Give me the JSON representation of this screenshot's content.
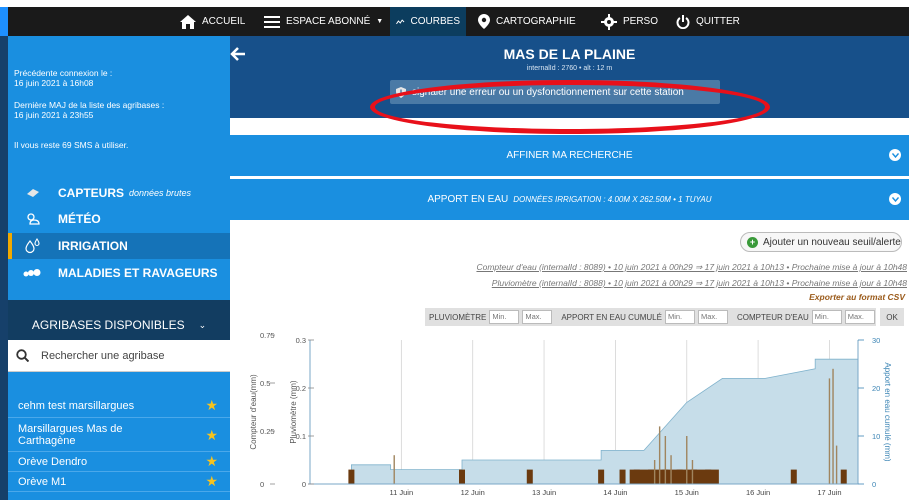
{
  "nav": {
    "items": [
      {
        "label": "ACCUEIL",
        "icon": "home-icon"
      },
      {
        "label": "ESPACE ABONNÉ",
        "icon": "menu-icon"
      },
      {
        "label": "COURBES",
        "icon": "chart-line-icon",
        "active": true
      },
      {
        "label": "CARTOGRAPHIE",
        "icon": "map-pin-icon"
      },
      {
        "label": "PERSO",
        "icon": "gear-icon"
      },
      {
        "label": "QUITTER",
        "icon": "power-icon"
      }
    ]
  },
  "sidebar": {
    "last_connection_label": "Précédente connexion le :",
    "last_connection_value": "16 juin 2021 à 16h08",
    "last_update_label": "Dernière MAJ de la liste des agribases :",
    "last_update_value": "16 juin 2021 à 23h55",
    "sms_left": "Il vous reste 69 SMS à utiliser.",
    "menu": [
      {
        "label": "CAPTEURS",
        "sub": "données brutes",
        "icon": "sensor-icon"
      },
      {
        "label": "MÉTÉO",
        "icon": "weather-icon"
      },
      {
        "label": "IRRIGATION",
        "icon": "water-drops-icon",
        "active": true
      },
      {
        "label": "MALADIES ET RAVAGEURS",
        "icon": "bug-icon"
      }
    ],
    "agribases_title": "AGRIBASES DISPONIBLES",
    "search_placeholder": "Rechercher une agribase",
    "agribases": [
      {
        "label": "cehm test marsillargues"
      },
      {
        "label": "Marsillargues Mas de Carthagène"
      },
      {
        "label": "Orève Dendro"
      },
      {
        "label": "Orève M1"
      }
    ]
  },
  "station": {
    "title": "MAS DE LA PLAINE",
    "subtitle": "internalId : 2760 • alt : 12 m",
    "report_button": "signaler une erreur ou un dysfonctionnement sur cette station"
  },
  "sections": {
    "refine": "AFFINER MA RECHERCHE",
    "water_title": "APPORT EN EAU",
    "water_sub": "DONNÉES IRRIGATION : 4.00M X 262.50M • 1 TUYAU"
  },
  "add_threshold": "Ajouter un nouveau seuil/alerte",
  "sources": [
    "Compteur d'eau (internalId : 8089) • 10 juin 2021 à 00h29 ⇒ 17 juin 2021 à 10h13 • Prochaine mise à jour à 10h48",
    "Pluviomètre (internalId : 8088) • 10 juin 2021 à 00h29 ⇒ 17 juin 2021 à 10h13 • Prochaine mise à jour à 10h48"
  ],
  "export_label": "Exporter au format CSV",
  "filters": {
    "pluvio": "PLUVIOMÈTRE",
    "cumul": "APPORT EN EAU CUMULÉ",
    "compteur": "COMPTEUR D'EAU",
    "min": "Min.",
    "max": "Max.",
    "ok": "OK"
  },
  "chart_data": {
    "type": "bar",
    "x_dates": [
      "11 Juin",
      "12 Juin",
      "13 Juin",
      "14 Juin",
      "15 Juin",
      "16 Juin",
      "17 Juin"
    ],
    "ylabel_left1": "Compteur d'eau(mm)",
    "ylabel_left2": "Pluviomètre (mm)",
    "ylabel_right": "Apport en eau cumulé (mm)",
    "y_left1_ticks": [
      "0",
      "0.25",
      "0.5",
      "0.75"
    ],
    "y_left2_ticks": [
      "0",
      "0.1",
      "0.2",
      "0.3"
    ],
    "y_right_ticks": [
      "0",
      "10",
      "20",
      "30"
    ],
    "ylim_left1": [
      0,
      0.75
    ],
    "ylim_left2": [
      0,
      0.3
    ],
    "ylim_right": [
      0,
      30
    ],
    "cumul_series": {
      "name": "Apport en eau cumulé",
      "color": "#c6dde9",
      "x": [
        10.3,
        10.85,
        10.85,
        11.85,
        11.85,
        13.8,
        13.8,
        14.4,
        15.0,
        15.5,
        16.1,
        16.8,
        16.8,
        17.4
      ],
      "y": [
        4,
        4,
        3,
        3,
        5,
        5,
        7,
        7,
        17,
        22,
        22,
        24,
        26,
        26
      ]
    },
    "compteur_bars": {
      "name": "Compteur d'eau",
      "color": "#6b3a0f",
      "x": [
        10.3,
        11.85,
        12.8,
        13.8,
        14.1,
        14.3,
        14.5,
        14.7,
        14.9,
        15.1,
        15.3,
        16.5,
        17.2
      ],
      "y": [
        0.1,
        0.1,
        0.1,
        0.1,
        0.1,
        0.1,
        0.1,
        0.1,
        0.1,
        0.1,
        0.1,
        0.1,
        0.1
      ]
    },
    "pluvio_bars": {
      "name": "Pluviomètre",
      "color": "#a0855f",
      "x": [
        10.9,
        14.55,
        14.62,
        14.7,
        14.78,
        15.0,
        15.08,
        17.0,
        17.05,
        17.1
      ],
      "y": [
        0.06,
        0.05,
        0.12,
        0.1,
        0.06,
        0.1,
        0.05,
        0.22,
        0.24,
        0.08
      ]
    }
  }
}
